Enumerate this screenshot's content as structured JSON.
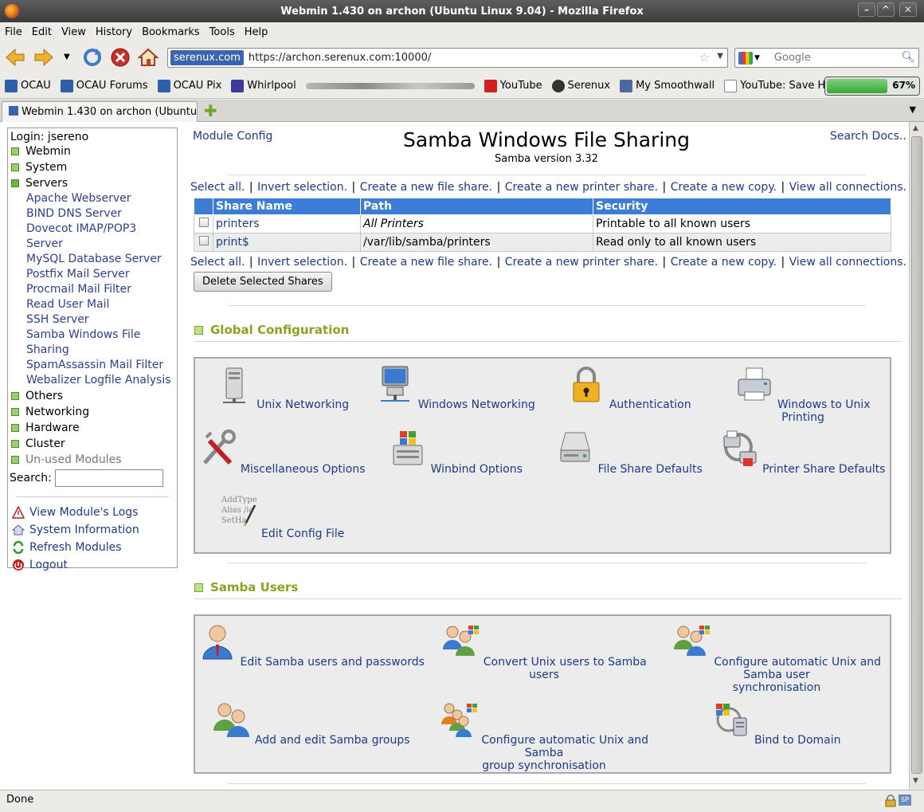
{
  "window": {
    "title": "Webmin 1.430 on archon (Ubuntu Linux 9.04) - Mozilla Firefox"
  },
  "menubar": [
    "File",
    "Edit",
    "View",
    "History",
    "Bookmarks",
    "Tools",
    "Help"
  ],
  "urlbar": {
    "site": "serenux.com",
    "url": "https://archon.serenux.com:10000/"
  },
  "searchbar": {
    "placeholder": "Google"
  },
  "bookmarks": [
    {
      "label": "OCAU",
      "icon": "ocau-icon"
    },
    {
      "label": "OCAU Forums",
      "icon": "ocau-icon"
    },
    {
      "label": "OCAU Pix",
      "icon": "ocau-icon"
    },
    {
      "label": "Whirlpool",
      "icon": "whirlpool-icon"
    },
    {
      "label": "YouTube",
      "icon": "youtube-icon"
    },
    {
      "label": "Serenux",
      "icon": "tux-icon"
    },
    {
      "label": "My Smoothwall",
      "icon": "smoothwall-icon"
    },
    {
      "label": "YouTube: Save HD video",
      "icon": "page-icon"
    }
  ],
  "bookmarks_overflow": "»",
  "battery": {
    "percent_label": "67%",
    "level": 0.67
  },
  "tabs": [
    {
      "label": "Webmin 1.430 on archon (Ubuntu …"
    }
  ],
  "sidebar": {
    "login": "Login: jsereno",
    "categories_top": [
      "Webmin",
      "System",
      "Servers"
    ],
    "modules": [
      "Apache Webserver",
      "BIND DNS Server",
      "Dovecot IMAP/POP3 Server",
      "MySQL Database Server",
      "Postfix Mail Server",
      "Procmail Mail Filter",
      "Read User Mail",
      "SSH Server",
      "Samba Windows File",
      "Sharing",
      "SpamAssassin Mail Filter",
      "Webalizer Logfile Analysis"
    ],
    "categories_bottom": [
      "Others",
      "Networking",
      "Hardware",
      "Cluster"
    ],
    "unused": "Un-used Modules",
    "search_label": "Search:",
    "actions": [
      "View Module's Logs",
      "System Information",
      "Refresh Modules",
      "Logout"
    ]
  },
  "main": {
    "module_config": "Module Config",
    "search_docs": "Search Docs..",
    "title": "Samba Windows File Sharing",
    "subtitle": "Samba version 3.32",
    "links": [
      "Select all.",
      "Invert selection.",
      "Create a new file share.",
      "Create a new printer share.",
      "Create a new copy.",
      "View all connections."
    ],
    "table": {
      "headers": [
        "Share Name",
        "Path",
        "Security"
      ],
      "rows": [
        {
          "name": "printers",
          "path": "All Printers",
          "security": "Printable to all known users"
        },
        {
          "name": "print$",
          "path": "/var/lib/samba/printers",
          "security": "Read only to all known users"
        }
      ]
    },
    "delete_button": "Delete Selected Shares",
    "global_title": "Global Configuration",
    "global_items": [
      "Unix Networking",
      "Windows Networking",
      "Authentication",
      "Windows to Unix Printing",
      "Miscellaneous Options",
      "Winbind Options",
      "File Share Defaults",
      "Printer Share Defaults",
      "Edit Config File"
    ],
    "config_file_art": [
      "AddType",
      "Alias /ic",
      "SetHa"
    ],
    "users_title": "Samba Users",
    "users_items": [
      [
        "Edit Samba users and passwords"
      ],
      [
        "Convert Unix users to Samba users"
      ],
      [
        "Configure automatic Unix and Samba user",
        "synchronisation"
      ],
      [
        "Add and edit Samba groups"
      ],
      [
        "Configure automatic Unix and Samba",
        "group synchronisation"
      ],
      [
        "Bind to Domain"
      ]
    ]
  },
  "status": {
    "text": "Done"
  }
}
